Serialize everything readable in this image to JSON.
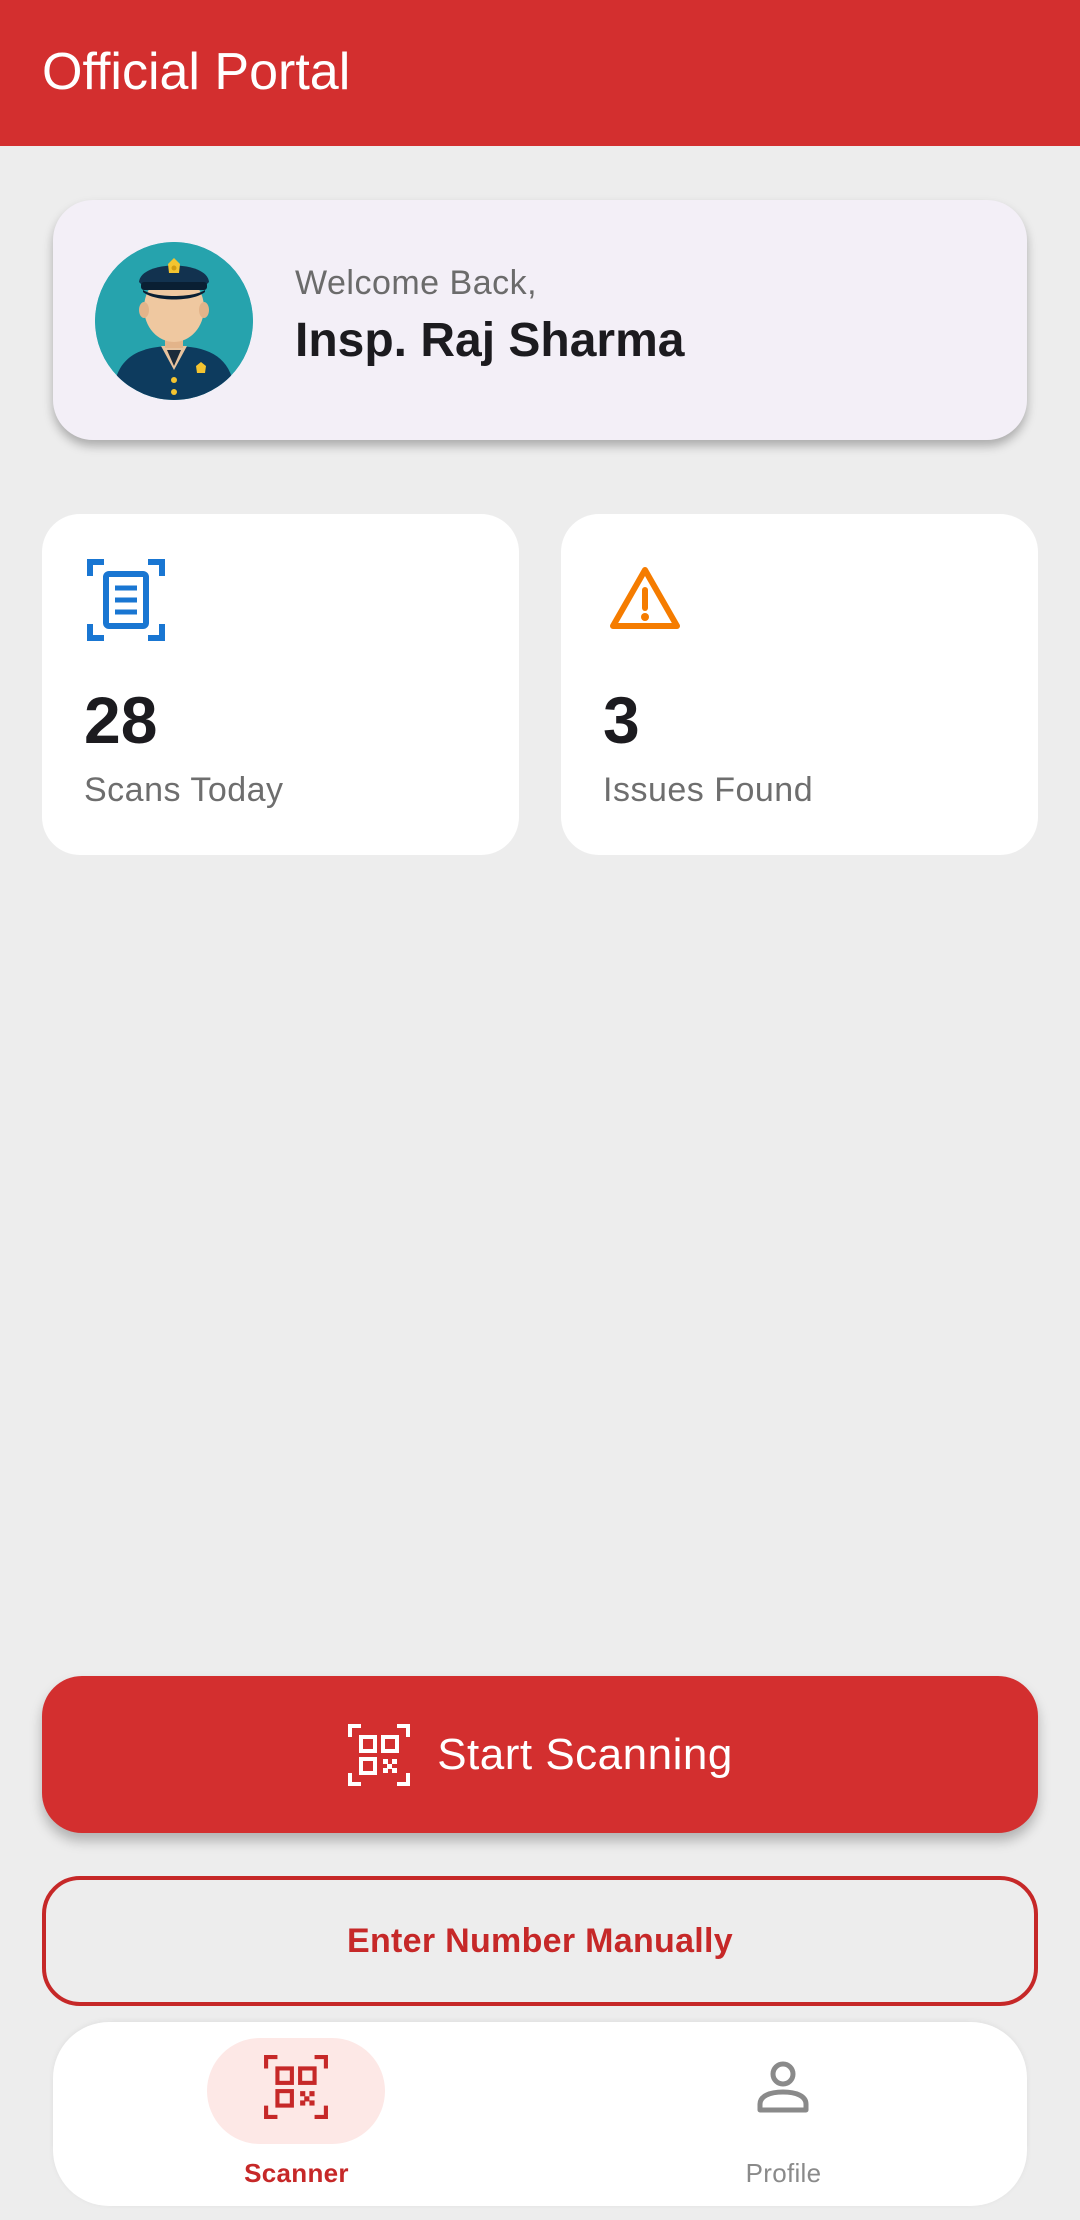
{
  "app_bar": {
    "title": "Official Portal"
  },
  "welcome_card": {
    "greeting": "Welcome Back,",
    "name": "Insp. Raj Sharma",
    "avatar_icon": "police-officer-avatar"
  },
  "stats": [
    {
      "value": "28",
      "label": "Scans Today",
      "icon": "document-scan-icon",
      "color": "#1976d2"
    },
    {
      "value": "3",
      "label": "Issues Found",
      "icon": "warning-icon",
      "color": "#f57c00"
    }
  ],
  "actions": {
    "start_scanning": {
      "label": "Start Scanning",
      "icon": "qr-code-scan-icon"
    },
    "enter_manually": {
      "label": "Enter Number Manually"
    }
  },
  "bottom_nav": {
    "items": [
      {
        "label": "Scanner",
        "icon": "qr-code-scan-icon",
        "selected": true
      },
      {
        "label": "Profile",
        "icon": "person-icon",
        "selected": false
      }
    ]
  },
  "colors": {
    "primary": "#d32f2f",
    "background": "#ededed",
    "welcome_card": "#f3eff7",
    "nav_selected_pill": "#fde8e6"
  }
}
